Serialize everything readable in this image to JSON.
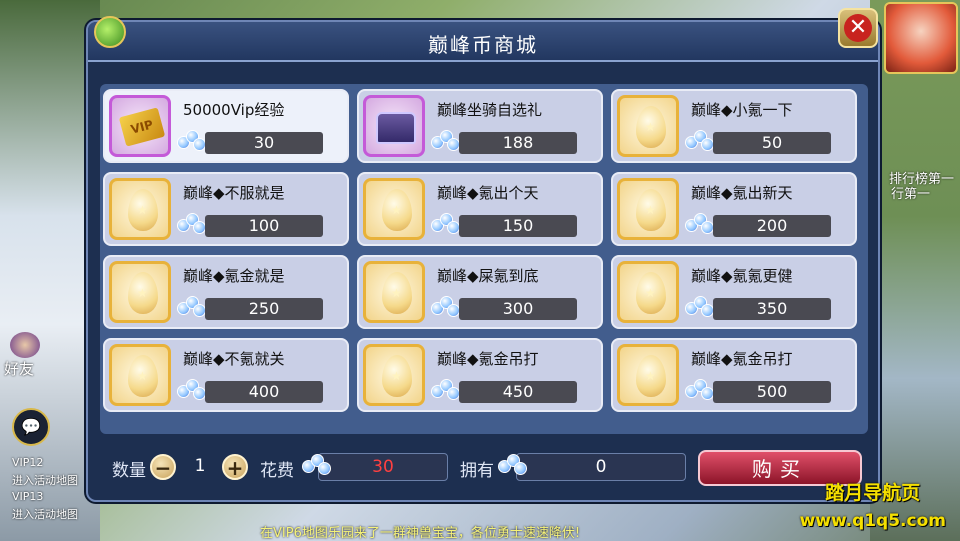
{
  "window": {
    "title": "巅峰币商城"
  },
  "side": {
    "rank1": "排行榜第一",
    "rank2": "行第一",
    "friend": "好友",
    "chat_lines": [
      "进入活动地图",
      "VIP12",
      "VIP13",
      "进入活动地图"
    ]
  },
  "items": [
    {
      "name": "50000Vip经验",
      "price": "30",
      "icon": "vip-card-icon",
      "frame": "purple",
      "selected": true
    },
    {
      "name": "巅峰坐骑自选礼",
      "price": "188",
      "icon": "chest-icon",
      "frame": "purple",
      "selected": false
    },
    {
      "name": "巅峰◆小氪一下",
      "price": "50",
      "icon": "egg-icon",
      "frame": "gold",
      "selected": false
    },
    {
      "name": "巅峰◆不服就是",
      "price": "100",
      "icon": "egg-icon",
      "frame": "gold",
      "selected": false
    },
    {
      "name": "巅峰◆氪出个天",
      "price": "150",
      "icon": "egg-icon",
      "frame": "gold",
      "selected": false
    },
    {
      "name": "巅峰◆氪出新天",
      "price": "200",
      "icon": "egg-icon",
      "frame": "gold",
      "selected": false
    },
    {
      "name": "巅峰◆氪金就是",
      "price": "250",
      "icon": "egg-icon",
      "frame": "gold",
      "selected": false
    },
    {
      "name": "巅峰◆屎氪到底",
      "price": "300",
      "icon": "egg-icon",
      "frame": "gold",
      "selected": false
    },
    {
      "name": "巅峰◆氪氪更健",
      "price": "350",
      "icon": "egg-icon",
      "frame": "gold",
      "selected": false
    },
    {
      "name": "巅峰◆不氪就关",
      "price": "400",
      "icon": "egg-icon",
      "frame": "gold",
      "selected": false
    },
    {
      "name": "巅峰◆氪金吊打",
      "price": "450",
      "icon": "egg-icon",
      "frame": "gold",
      "selected": false
    },
    {
      "name": "巅峰◆氪金吊打",
      "price": "500",
      "icon": "egg-icon",
      "frame": "gold",
      "selected": false
    }
  ],
  "purchase": {
    "qty_label": "数量",
    "qty_minus": "−",
    "qty_value": "1",
    "qty_plus": "+",
    "cost_label": "花费",
    "cost_value": "30",
    "own_label": "拥有",
    "own_value": "0",
    "buy_label": "购买"
  },
  "colors": {
    "cost": "#ff4040",
    "own": "#ffffff",
    "accent": "#c8231f"
  },
  "watermark": {
    "line1": "踏月导航页",
    "line2": "www.q1q5.com"
  },
  "ticker": "在VIP6地图乐园来了一群神兽宝宝，各位勇士速速降伏!"
}
